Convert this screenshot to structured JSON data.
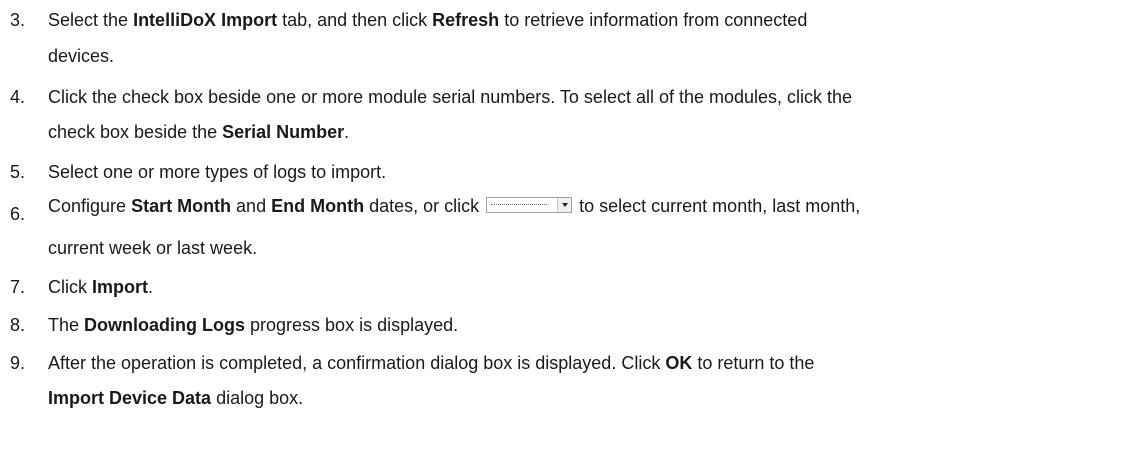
{
  "steps": [
    {
      "number": "3.",
      "lines": [
        [
          {
            "t": "Select the "
          },
          {
            "t": "IntelliDoX Import",
            "b": true
          },
          {
            "t": " tab, and then click "
          },
          {
            "t": "Refresh",
            "b": true
          },
          {
            "t": " to retrieve information from connected"
          }
        ],
        [
          {
            "t": "devices."
          }
        ]
      ]
    },
    {
      "number": "4.",
      "lines": [
        [
          {
            "t": "Click the check box beside one or more module serial numbers. To select all of the modules, click the"
          }
        ],
        [
          {
            "t": "check box beside the "
          },
          {
            "t": "Serial Number",
            "b": true
          },
          {
            "t": "."
          }
        ]
      ]
    },
    {
      "number": "5.",
      "lines": [
        [
          {
            "t": "Select one or more types of logs to import."
          }
        ]
      ]
    },
    {
      "number": "6.",
      "lines": [
        [
          {
            "t": "Configure "
          },
          {
            "t": "Start Month",
            "b": true
          },
          {
            "t": " and "
          },
          {
            "t": "End Month",
            "b": true
          },
          {
            "t": " dates, or click "
          },
          {
            "dropdown": true
          },
          {
            "t": " to select current month, last month,"
          }
        ],
        [
          {
            "t": "current week or last week."
          }
        ]
      ]
    },
    {
      "number": "7.",
      "lines": [
        [
          {
            "t": "Click "
          },
          {
            "t": "Import",
            "b": true
          },
          {
            "t": "."
          }
        ]
      ]
    },
    {
      "number": "8.",
      "lines": [
        [
          {
            "t": "The "
          },
          {
            "t": "Downloading Logs",
            "b": true
          },
          {
            "t": " progress box is displayed."
          }
        ]
      ]
    },
    {
      "number": "9.",
      "lines": [
        [
          {
            "t": "After the operation is completed, a confirmation dialog box is displayed. Click "
          },
          {
            "t": "OK",
            "b": true
          },
          {
            "t": " to return to the"
          }
        ],
        [
          {
            "t": "Import Device Data",
            "b": true
          },
          {
            "t": " dialog box."
          }
        ]
      ]
    }
  ]
}
